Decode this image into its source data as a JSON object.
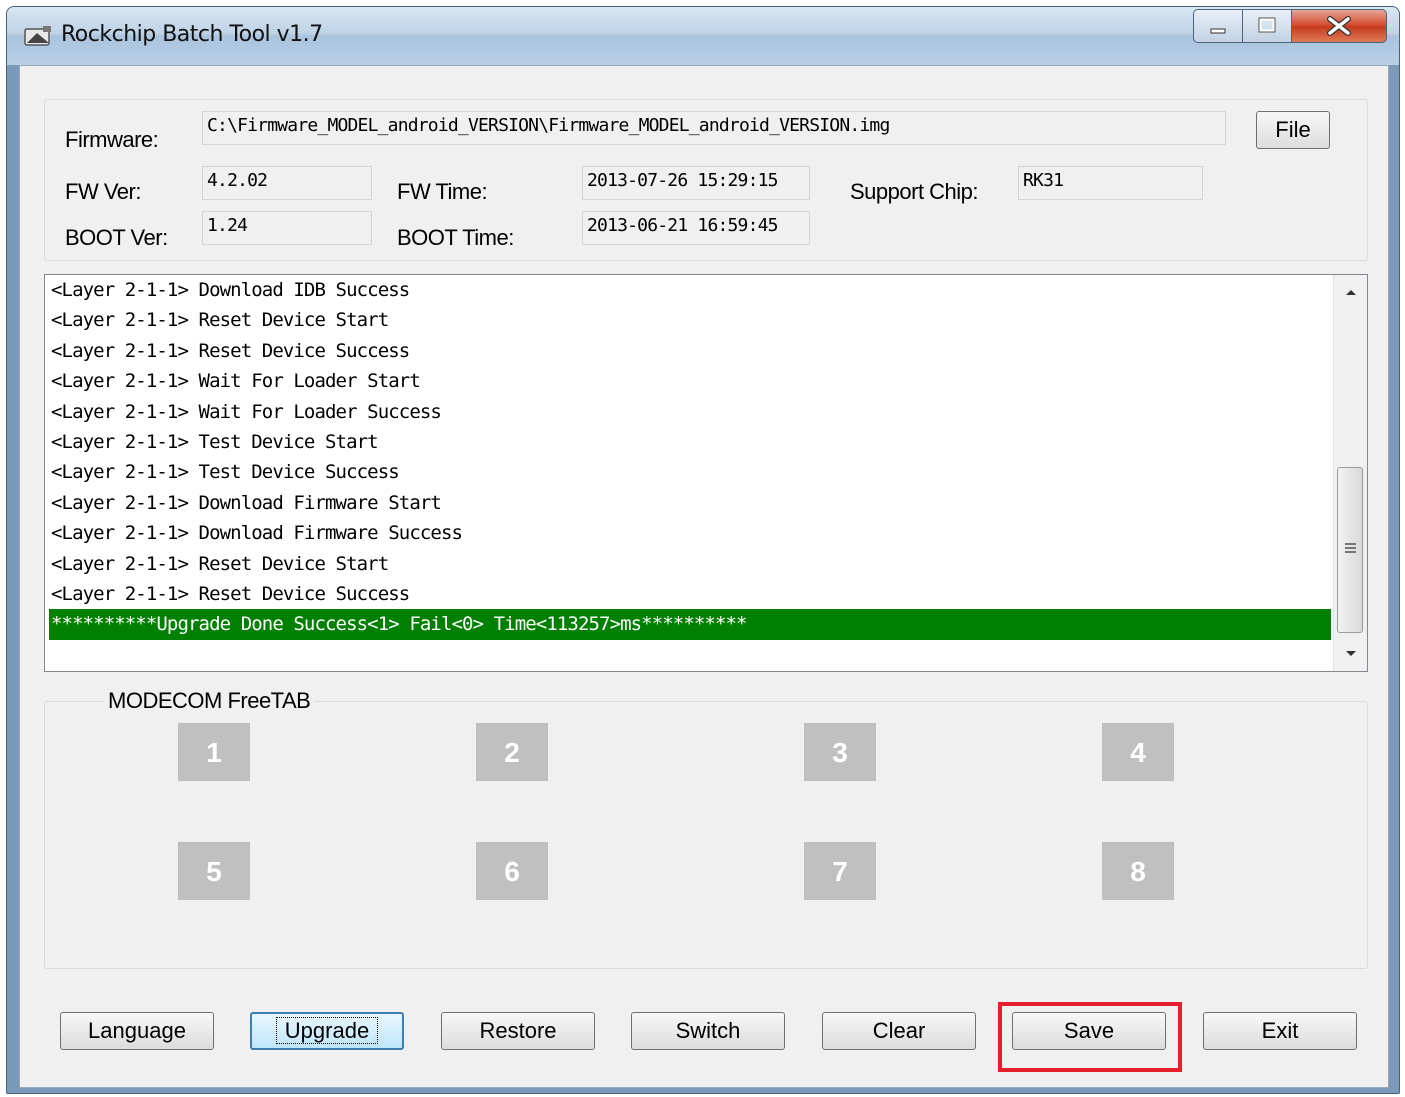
{
  "window": {
    "title": "Rockchip Batch Tool v1.7",
    "icon": "rockchip-app-icon"
  },
  "firmware": {
    "label": "Firmware:",
    "path": "C:\\Firmware_MODEL_android_VERSION\\Firmware_MODEL_android_VERSION.img",
    "file_button": "File"
  },
  "fw_ver": {
    "label": "FW Ver:",
    "value": "4.2.02"
  },
  "boot_ver": {
    "label": "BOOT Ver:",
    "value": "1.24"
  },
  "fw_time": {
    "label": "FW Time:",
    "value": "2013-07-26 15:29:15"
  },
  "boot_time": {
    "label": "BOOT Time:",
    "value": "2013-06-21 16:59:45"
  },
  "support_chip": {
    "label": "Support Chip:",
    "value": "RK31"
  },
  "log": {
    "lines": [
      "<Layer 2-1-1> Download IDB Success",
      "<Layer 2-1-1> Reset Device Start",
      "<Layer 2-1-1> Reset Device Success",
      "<Layer 2-1-1> Wait For Loader Start",
      "<Layer 2-1-1> Wait For Loader Success",
      "<Layer 2-1-1> Test Device Start",
      "<Layer 2-1-1> Test Device Success",
      "<Layer 2-1-1> Download Firmware Start",
      "<Layer 2-1-1> Download Firmware Success",
      "<Layer 2-1-1> Reset Device Start",
      "<Layer 2-1-1> Reset Device Success",
      "**********Upgrade Done Success<1> Fail<0> Time<113257>ms**********"
    ],
    "highlight_color": "#008000"
  },
  "devices": {
    "group_title": "MODECOM FreeTAB",
    "slots": [
      "1",
      "2",
      "3",
      "4",
      "5",
      "6",
      "7",
      "8"
    ],
    "slot_color": "#c0c0c0"
  },
  "actions": {
    "language": "Language",
    "upgrade": "Upgrade",
    "restore": "Restore",
    "switch": "Switch",
    "clear": "Clear",
    "save": "Save",
    "exit": "Exit"
  },
  "annotation": {
    "highlight_color": "#e4202a",
    "target": "save-button"
  }
}
